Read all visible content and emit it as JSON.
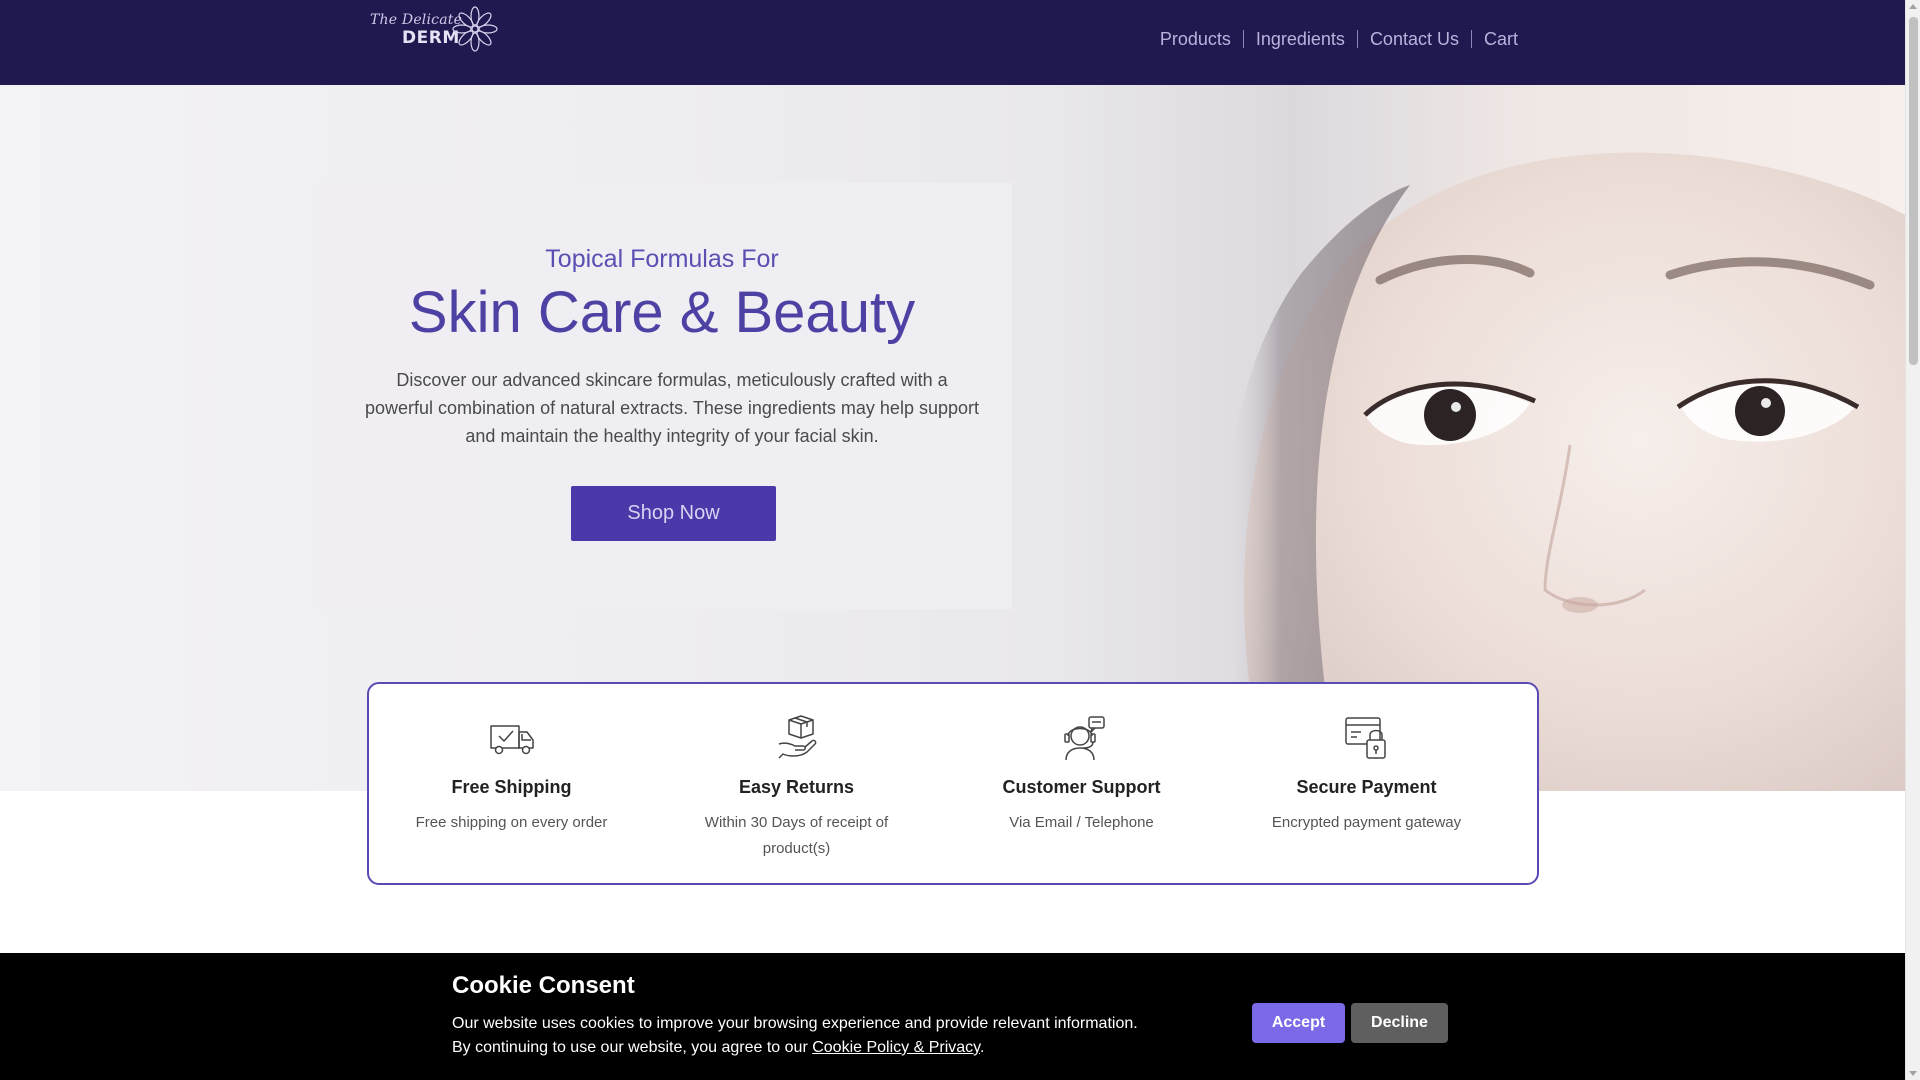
{
  "header": {
    "logo": {
      "script": "The Delicate",
      "brand": "DERM"
    },
    "nav": [
      "Products",
      "Ingredients",
      "Contact Us",
      "Cart"
    ]
  },
  "hero": {
    "subtitle": "Topical Formulas For",
    "title": "Skin Care & Beauty",
    "text": "Discover our advanced skincare formulas, meticulously crafted with a powerful combination of natural extracts. These ingredients may help support and maintain the healthy integrity of your facial skin.",
    "cta": "Shop Now"
  },
  "features": [
    {
      "icon": "delivery-truck-icon",
      "title": "Free Shipping",
      "desc": "Free shipping on every order"
    },
    {
      "icon": "box-return-icon",
      "title": "Easy Returns",
      "desc": "Within 30 Days of receipt of product(s)"
    },
    {
      "icon": "customer-support-icon",
      "title": "Customer Support",
      "desc": "Via Email / Telephone"
    },
    {
      "icon": "secure-payment-icon",
      "title": "Secure Payment",
      "desc": "Encrypted payment gateway"
    }
  ],
  "cookie": {
    "title": "Cookie Consent",
    "text_line1": "Our website uses cookies to improve your browsing experience and provide relevant information.",
    "text_line2_prefix": "By continuing to use our website, you agree to our ",
    "link": "Cookie Policy & Privacy",
    "text_line2_suffix": ".",
    "accept": "Accept",
    "decline": "Decline"
  },
  "colors": {
    "header_bg": "#20194f",
    "accent": "#4b38a9",
    "accept_button": "#7a6ae8",
    "decline_button": "#5f5f5f"
  }
}
